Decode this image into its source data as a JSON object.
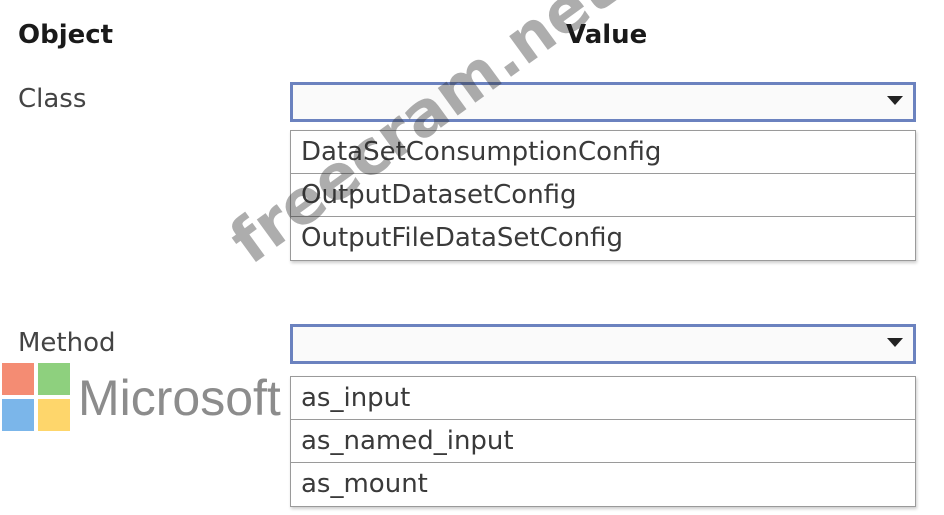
{
  "headers": {
    "object": "Object",
    "value": "Value"
  },
  "rows": [
    {
      "label": "Class",
      "selected": "",
      "options": [
        "DataSetConsumptionConfig",
        "OutputDatasetConfig",
        "OutputFileDataSetConfig"
      ]
    },
    {
      "label": "Method",
      "selected": "",
      "options": [
        "as_input",
        "as_named_input",
        "as_mount"
      ]
    }
  ],
  "logo": {
    "text": "Microsoft",
    "colors": [
      "#f48c73",
      "#8ed07e",
      "#7bb6ea",
      "#fed66b"
    ]
  },
  "watermark": {
    "text": "freecram.net"
  }
}
